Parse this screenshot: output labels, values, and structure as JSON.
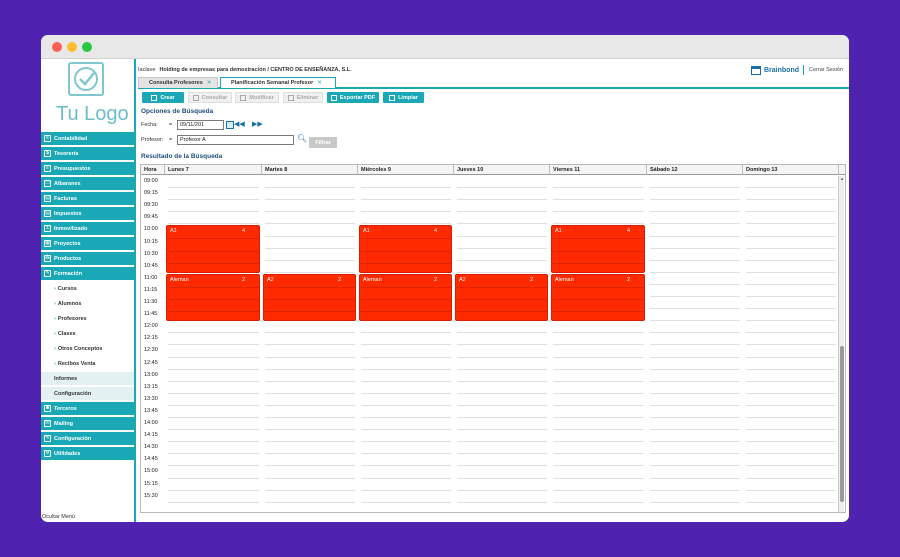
{
  "company": {
    "label": "Iaclave",
    "name": "Holding de empresas para demostración / CENTRO DE ENSEÑANZA, S.L."
  },
  "brand": {
    "name": "Brainbond",
    "logout": "Cerrar Sesión"
  },
  "logo": {
    "text": "Tu Logo"
  },
  "sidebar": {
    "items": [
      {
        "label": "Contabilidad",
        "icon": "book-icon"
      },
      {
        "label": "Tesorería",
        "icon": "dollar-icon"
      },
      {
        "label": "Presupuestos",
        "icon": "docs-icon"
      },
      {
        "label": "Albaranes",
        "icon": "truck-icon"
      },
      {
        "label": "Facturas",
        "icon": "invoice-icon"
      },
      {
        "label": "Impuestos",
        "icon": "tax-icon"
      },
      {
        "label": "Inmovilizado",
        "icon": "anchor-icon"
      },
      {
        "label": "Proyectos",
        "icon": "project-icon"
      },
      {
        "label": "Productos",
        "icon": "product-icon"
      },
      {
        "label": "Formación",
        "icon": "wrench-icon"
      }
    ],
    "sub_items": [
      "Cursos",
      "Alumnos",
      "Profesores",
      "Clases",
      "Otros Conceptos",
      "Recibos Venta"
    ],
    "plain_items": [
      "Informes",
      "Configuración"
    ],
    "bottom_items": [
      {
        "label": "Terceros",
        "icon": "users-icon"
      },
      {
        "label": "Mailing",
        "icon": "mail-icon"
      },
      {
        "label": "Configuración",
        "icon": "config-icon"
      },
      {
        "label": "Utilidades",
        "icon": "gear-icon"
      }
    ],
    "hide_menu": "Ocultar Menú"
  },
  "tabs": [
    {
      "label": "Consulta Profesores",
      "active": false
    },
    {
      "label": "Planificación Semanal Profesor",
      "active": true
    }
  ],
  "toolbar": {
    "crear": "Crear",
    "consultar": "Consultar",
    "modificar": "Modificar",
    "eliminar": "Eliminar",
    "exportar": "Exportar PDF",
    "limpiar": "Limpiar"
  },
  "options": {
    "title": "Opciones de Búsqueda",
    "fecha_label": "Fecha:",
    "fecha_value": "09/11/201",
    "profesor_label": "Profesor:",
    "profesor_value": "Profesor A",
    "operator": "=",
    "filtrar": "Filtrar"
  },
  "results": {
    "title": "Resultado de la Búsqueda",
    "columns": [
      "Hora",
      "Lunes 7",
      "Martes 8",
      "Miércoles 9",
      "Jueves 10",
      "Viernes 11",
      "Sábado 12",
      "Domingo 13"
    ],
    "hours": [
      "09:00",
      "09:15",
      "09:30",
      "09:45",
      "10:00",
      "10:15",
      "10:30",
      "10:45",
      "11:00",
      "11:15",
      "11:30",
      "11:45",
      "12:00",
      "12:15",
      "12:30",
      "12:45",
      "13:00",
      "13:15",
      "13:30",
      "13:45",
      "14:00",
      "14:15",
      "14:30",
      "14:45",
      "15:00",
      "15:15",
      "15:30"
    ]
  },
  "events": [
    {
      "day": 0,
      "start": 4,
      "slots": 4,
      "name": "A1",
      "count": "4"
    },
    {
      "day": 2,
      "start": 4,
      "slots": 4,
      "name": "A1",
      "count": "4"
    },
    {
      "day": 4,
      "start": 4,
      "slots": 4,
      "name": "A1",
      "count": "4"
    },
    {
      "day": 0,
      "start": 8,
      "slots": 4,
      "name": "Aleman",
      "count": "2"
    },
    {
      "day": 1,
      "start": 8,
      "slots": 4,
      "name": "A2",
      "count": "2"
    },
    {
      "day": 2,
      "start": 8,
      "slots": 4,
      "name": "Aleman",
      "count": "2"
    },
    {
      "day": 3,
      "start": 8,
      "slots": 4,
      "name": "A2",
      "count": "2"
    },
    {
      "day": 4,
      "start": 8,
      "slots": 4,
      "name": "Aleman",
      "count": "2"
    }
  ],
  "colors": {
    "accent": "#1aa8b7",
    "event": "#ff2a00",
    "background": "#4f23b0"
  }
}
